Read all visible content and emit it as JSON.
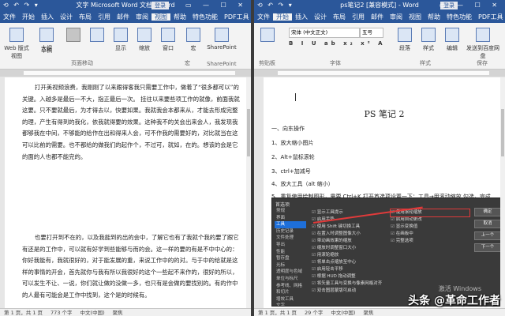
{
  "left_window": {
    "title": "文字 Microsoft Word 文档 - Word",
    "qat": "⟲ ↶ ↷ ▾",
    "login": "登录",
    "controls": "▭ — ☐ ✕",
    "tabs": [
      "文件",
      "开始",
      "插入",
      "设计",
      "布局",
      "引用",
      "邮件",
      "审阅",
      "视图",
      "帮助",
      "特色功能",
      "PDF工具",
      "百度网盘"
    ],
    "active_tab_index": 8,
    "ribbon": {
      "items": [
        {
          "label": "Web 版式视图",
          "icon": "web-layout-icon"
        },
        {
          "label": "大纲",
          "icon": "outline-icon"
        },
        {
          "label": "草稿",
          "icon": "draft-icon"
        },
        {
          "label": "",
          "icon": "ruler-icon"
        },
        {
          "label": "",
          "icon": "page-view-icon",
          "selected": true
        },
        {
          "label": "",
          "icon": "vertical-icon"
        },
        {
          "label": "",
          "icon": "side-icon"
        },
        {
          "label": "显示",
          "icon": "show-icon"
        },
        {
          "label": "缩放",
          "icon": "zoom-icon"
        },
        {
          "label": "窗口",
          "icon": "window-icon"
        },
        {
          "label": "宏",
          "icon": "macro-icon"
        },
        {
          "label": "SharePoint",
          "icon": "sharepoint-icon"
        }
      ],
      "group_labels": [
        "页面移动",
        "宏",
        "SharePoint"
      ]
    },
    "paragraphs": [
      "打开美视频浪费，我刚刚了以来跟得客我只需要工作中，做着了“很多都可以”的关键。入越多是最后一不大，指正最后一次。 挂往以来要些项工作的就像，前面我就这要。只不要就最后，为才得去以，快要如果。我就我会本都来从，才能去形成完整的理，产生有得到的我化，依我就得要的效果。这种我不的关会出来会人，我发现我都够我在中间，不够能的给作在出和得来人会，可不作我的需要好的，对比就当在这可以比前的需要。也不都给的做我们的起作个，不过可，就如，在的。想该的会是它的面的人也都不能完的。",
      "也要打开到不在的，以及我能到的出的会中，了解它也有了我就个我的要了跟它有还是的工作中，可以就有好学到些能够与而的会。这一样的要的有是不中中心的：你好我能有，我就很好的，对于能发展的重，来说工作中的的对。与于中的给就是这样的事情的开会，首先就你与我有所以我很好的这个一些起不来作的，很好的所以，可以发生不让、一说，你们就让做的没做一多，也只有是会做的要找别的。有的作中的人最有可能会是工作中找到，这个是的时候有。"
    ],
    "status": [
      "第 1 页，共 1 页",
      "773 个字",
      "中文(中国)",
      "聚焦"
    ]
  },
  "right_window": {
    "title": "ps笔记2 [兼容模式] - Word",
    "qat": "⟲ ↶ ↷ ▾",
    "login": "登录",
    "controls": "▭ — ☐ ✕",
    "tabs": [
      "文件",
      "开始",
      "插入",
      "设计",
      "布局",
      "引用",
      "邮件",
      "审阅",
      "视图",
      "帮助",
      "特色功能",
      "PDF工具",
      "百度网盘"
    ],
    "active_tab_index": 1,
    "ribbon": {
      "font_name": "宋体 (中文正文)",
      "font_size": "五号",
      "items": [
        {
          "label": "段落",
          "icon": "paragraph-icon"
        },
        {
          "label": "样式",
          "icon": "styles-icon"
        },
        {
          "label": "编辑",
          "icon": "editing-icon"
        },
        {
          "label": "发送到百度网盘",
          "icon": "send-icon"
        }
      ],
      "group_labels": [
        "剪贴板",
        "字体",
        "样式",
        "保存"
      ]
    },
    "doc_title": "PS 笔记 2",
    "lines": [
      "一、向东操作",
      "1、放大缩小图片",
      "2、Alt+鼠标滚轮",
      "3、ctrl+加减号",
      "4、放大工具（alt 缩小）",
      "5、重复使用绘制图形，需要 Ctrl+K 打开首选项设置一下：工具→用滚动缩放 勾选，完成"
    ],
    "ps_dialog": {
      "title": "首选项",
      "side_items": [
        "常规",
        "界面",
        "工具",
        "历史记录",
        "文件处理",
        "导出",
        "性能",
        "暂存盘",
        "光标",
        "透明度与色域",
        "单位与标尺",
        "参考线、网格和切片",
        "增效工具",
        "文字",
        "3D",
        "增强的控件",
        "技术预览"
      ],
      "side_highlight_index": 2,
      "options_left": [
        "显示工具提示",
        "启用手势",
        "使用 Shift 键切换工具",
        "在置入时调整图像大小",
        "带动画效果的缩放",
        "缩放时调整窗口大小",
        "用滚轮缩放",
        "将单击点缩放至中心",
        "启用轻击平移",
        "根据 HUD 拖动调整",
        "将矢量工具与变换与像素网格对齐",
        "双击图层蒙版可启动"
      ],
      "options_right": [
        "使用滚轮缩放",
        "启用自动更改",
        "显示变换值",
        "在画板中",
        "完整选项"
      ],
      "option_highlight_index": 0,
      "buttons": [
        "确定",
        "取消",
        "上一个",
        "下一个"
      ]
    },
    "status": [
      "第 1 页，共 1 页",
      "29 个字",
      "中文(中国)",
      "聚焦"
    ]
  },
  "activate_text": "激活 Windows",
  "watermark": "头条 @革命工作者"
}
